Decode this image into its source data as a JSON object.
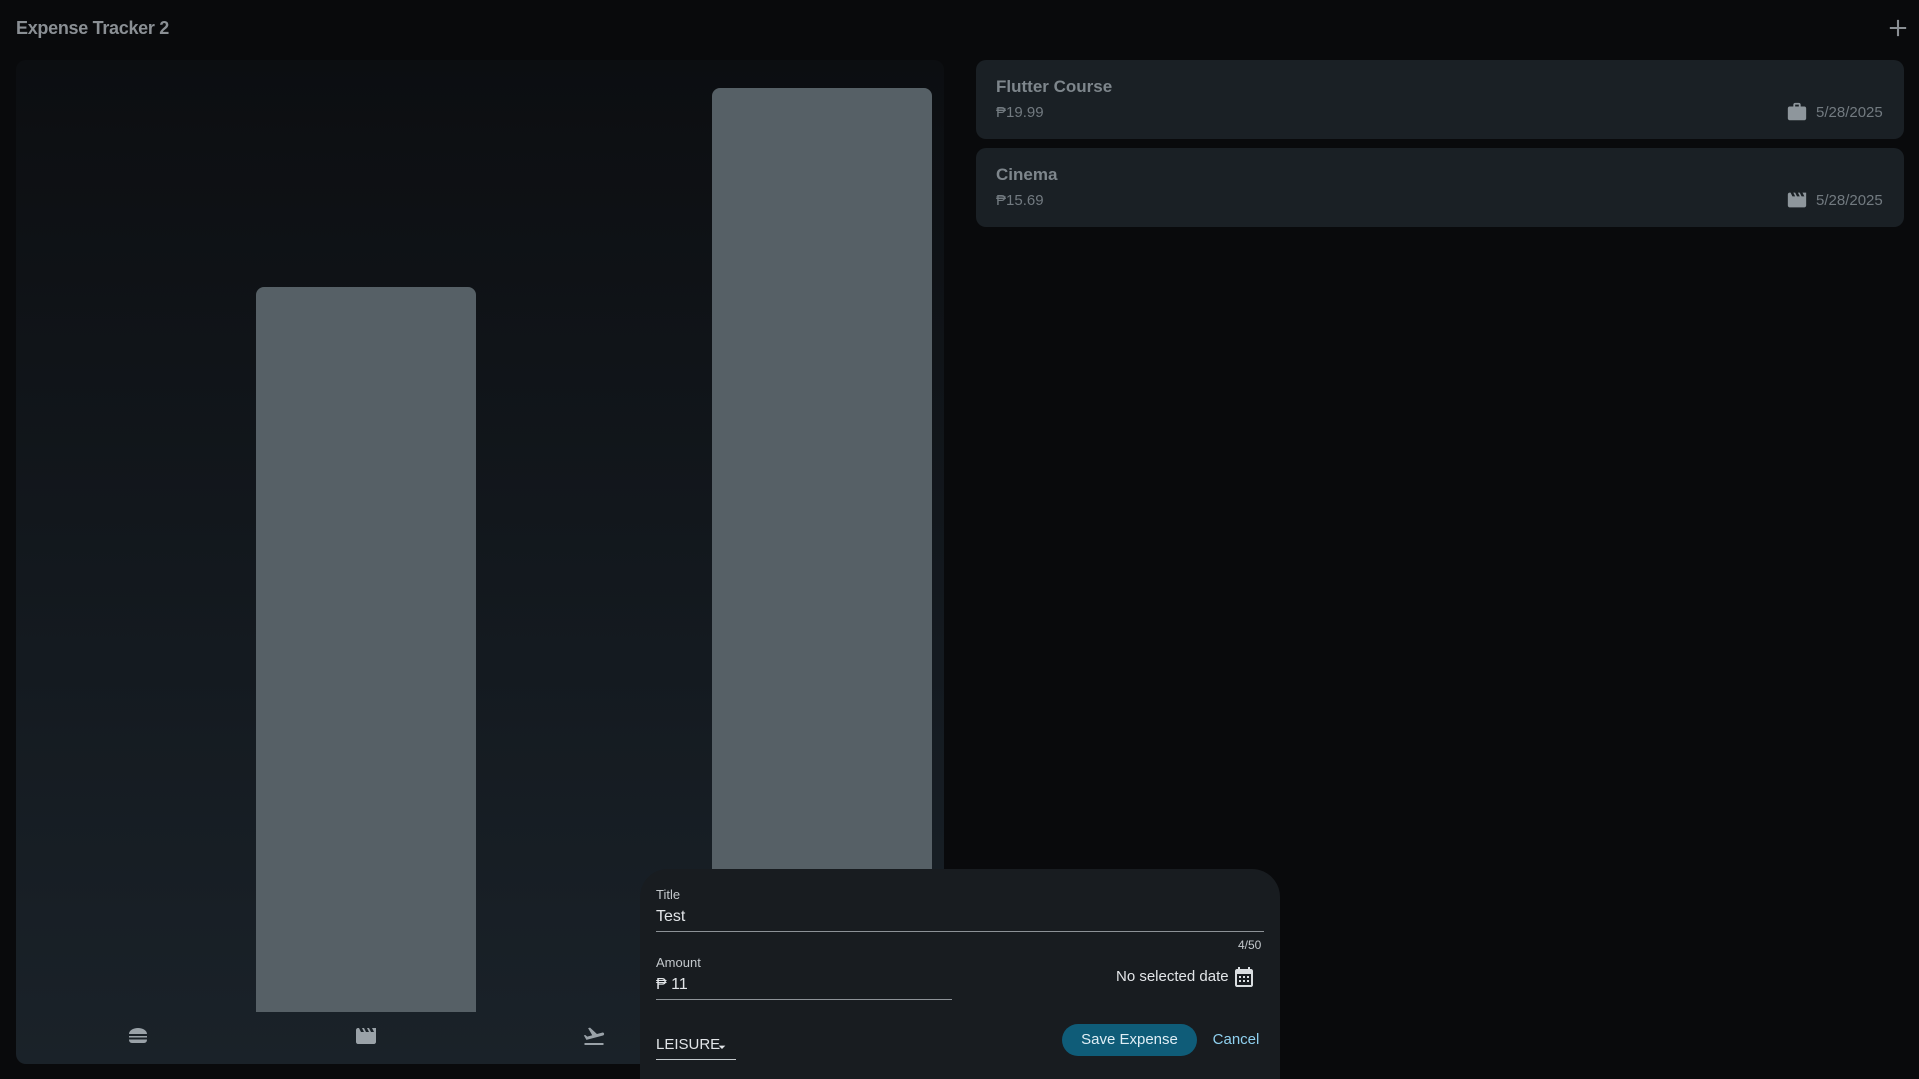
{
  "app": {
    "title": "Expense Tracker 2"
  },
  "header": {
    "add_icon": "add-icon"
  },
  "chart_data": {
    "type": "bar",
    "categories": [
      "food",
      "leisure",
      "travel",
      "work"
    ],
    "category_icons": [
      "lunch-icon",
      "movie-icon",
      "flight-takeoff-icon",
      "work-icon"
    ],
    "values": [
      0,
      15.69,
      0,
      19.99
    ],
    "ylim": [
      0,
      19.99
    ]
  },
  "expenses": [
    {
      "title": "Flutter Course",
      "amount": "₱19.99",
      "icon": "work-icon",
      "date": "5/28/2025"
    },
    {
      "title": "Cinema",
      "amount": "₱15.69",
      "icon": "movie-icon",
      "date": "5/28/2025"
    }
  ],
  "form": {
    "title_label": "Title",
    "title_value": "Test",
    "title_counter": "4/50",
    "amount_label": "Amount",
    "amount_value": "₱ 11",
    "date_text": "No selected date",
    "category_value": "LEISURE",
    "save_label": "Save Expense",
    "cancel_label": "Cancel"
  },
  "colors": {
    "background": "#090a0c",
    "bar": "#566066",
    "card": "#1a2025",
    "sheet": "#181c20",
    "primary_button": "#0f5c78",
    "text_button": "#8fd0ef"
  }
}
